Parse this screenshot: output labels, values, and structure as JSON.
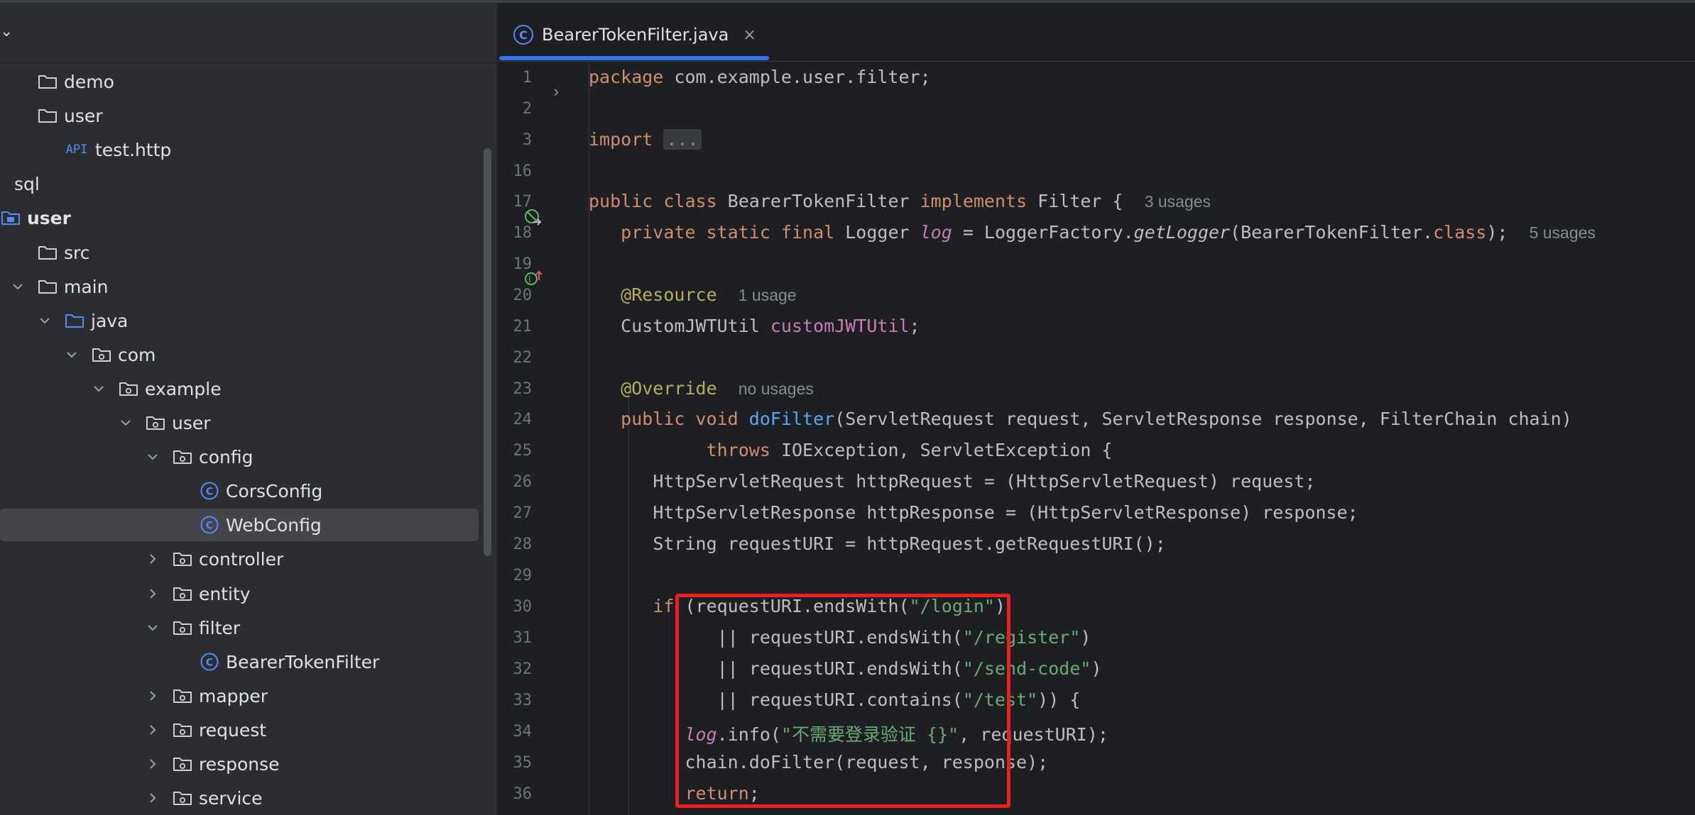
{
  "colors": {
    "accent": "#3574f0",
    "class_icon": "#548af7",
    "highlight_box": "#ee1f1f",
    "keyword": "#cf8e6d",
    "string": "#6aab73",
    "annotation": "#b3ae60",
    "field": "#c77dbb",
    "method": "#56a8f5"
  },
  "sidebar": {
    "items": [
      {
        "label": "demo",
        "icon": "folder-icon"
      },
      {
        "label": "user",
        "icon": "folder-icon"
      },
      {
        "label": "test.http",
        "icon": "api-file-icon",
        "badge": "API"
      },
      {
        "label": "sql",
        "icon": "folder-icon"
      },
      {
        "label": "user",
        "icon": "module-icon"
      },
      {
        "label": "src",
        "icon": "folder-icon"
      },
      {
        "label": "main",
        "icon": "folder-icon",
        "expanded": true
      },
      {
        "label": "java",
        "icon": "source-folder-icon",
        "expanded": true
      },
      {
        "label": "com",
        "icon": "package-icon",
        "expanded": true
      },
      {
        "label": "example",
        "icon": "package-icon",
        "expanded": true
      },
      {
        "label": "user",
        "icon": "package-icon",
        "expanded": true
      },
      {
        "label": "config",
        "icon": "package-icon",
        "expanded": true
      },
      {
        "label": "CorsConfig",
        "icon": "class-icon"
      },
      {
        "label": "WebConfig",
        "icon": "class-icon",
        "selected": true
      },
      {
        "label": "controller",
        "icon": "package-icon",
        "expanded": false
      },
      {
        "label": "entity",
        "icon": "package-icon",
        "expanded": false
      },
      {
        "label": "filter",
        "icon": "package-icon",
        "expanded": true
      },
      {
        "label": "BearerTokenFilter",
        "icon": "class-icon"
      },
      {
        "label": "mapper",
        "icon": "package-icon",
        "expanded": false
      },
      {
        "label": "request",
        "icon": "package-icon",
        "expanded": false
      },
      {
        "label": "response",
        "icon": "package-icon",
        "expanded": false
      },
      {
        "label": "service",
        "icon": "package-icon",
        "expanded": false
      }
    ]
  },
  "editor": {
    "tab": {
      "label": "BearerTokenFilter.java",
      "close": "×",
      "icon_letter": "C"
    },
    "line_numbers": [
      "1",
      "2",
      "3",
      "16",
      "17",
      "18",
      "19",
      "20",
      "21",
      "22",
      "23",
      "24",
      "25",
      "26",
      "27",
      "28",
      "29",
      "30",
      "31",
      "32",
      "33",
      "34",
      "35",
      "36"
    ],
    "fold_arrow": "›",
    "code": {
      "l1_kw": "package",
      "l1_rest": " com.example.user.filter;",
      "l3_kw": "import",
      "l3_fold": "...",
      "l17_kw": "public class",
      "l17_name": " BearerTokenFilter ",
      "l17_kw2": "implements",
      "l17_rest": " Filter {",
      "l17_hint": "3 usages",
      "l18_kw": "private static final",
      "l18_type": " Logger ",
      "l18_field": "log",
      "l18_mid": " = LoggerFactory.",
      "l18_method": "getLogger",
      "l18_args": "(BearerTokenFilter.",
      "l18_class": "class",
      "l18_end": ");",
      "l18_hint": "5 usages",
      "l20_ann": "@Resource",
      "l20_hint": "1 usage",
      "l21_type": "CustomJWTUtil ",
      "l21_field": "customJWTUtil",
      "l21_end": ";",
      "l23_ann": "@Override",
      "l23_hint": "no usages",
      "l24_kw": "public void",
      "l24_method": "doFilter",
      "l24_rest": "(ServletRequest request, ServletResponse response, FilterChain chain)",
      "l25_kw": "throws",
      "l25_rest": " IOException, ServletException {",
      "l26": "HttpServletRequest httpRequest = (HttpServletRequest) request;",
      "l27": "HttpServletResponse httpResponse = (HttpServletResponse) response;",
      "l28": "String requestURI = httpRequest.getRequestURI();",
      "l30_kw": "if",
      "l30_a": " (requestURI.endsWith(",
      "l30_str": "\"/login\"",
      "l30_b": ")",
      "l31_a": "|| requestURI.endsWith(",
      "l31_str": "\"/register\"",
      "l31_b": ")",
      "l32_a": "|| requestURI.endsWith(",
      "l32_str": "\"/send-code\"",
      "l32_b": ")",
      "l33_a": "|| requestURI.contains(",
      "l33_str": "\"/test\"",
      "l33_b": ")) {",
      "l34_field": "log",
      "l34_a": ".info(",
      "l34_str": "\"不需要登录验证 {}\"",
      "l34_b": ", requestURI);",
      "l35": "chain.doFilter(request, response);",
      "l36_kw": "return",
      "l36_end": ";"
    }
  }
}
